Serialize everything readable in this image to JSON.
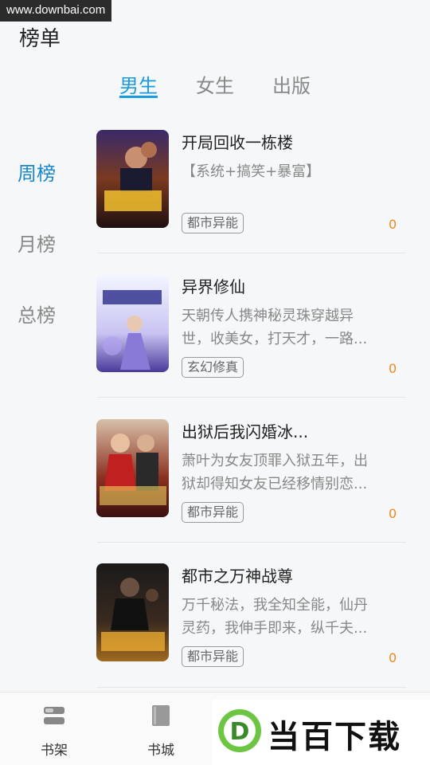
{
  "watermark": {
    "site": "www.downbai.com",
    "brand": "当百下载",
    "logo_letter": "D"
  },
  "page": {
    "title": "榜单"
  },
  "tabs": [
    {
      "label": "男生",
      "active": true
    },
    {
      "label": "女生",
      "active": false
    },
    {
      "label": "出版",
      "active": false
    }
  ],
  "side_nav": [
    {
      "label": "周榜",
      "active": true
    },
    {
      "label": "月榜",
      "active": false
    },
    {
      "label": "总榜",
      "active": false
    }
  ],
  "books": [
    {
      "title": "开局回收一栋楼",
      "desc": "【系统+搞笑+暴富】",
      "tag": "都市异能",
      "count": "0",
      "cover_text": "开局回收一栋楼"
    },
    {
      "title": "异界修仙",
      "desc": "天朝传人携神秘灵珠穿越异世，收美女，打天才，一路...",
      "tag": "玄幻修真",
      "count": "0",
      "cover_text": "异界修仙"
    },
    {
      "title": "出狱后我闪婚冰...",
      "desc": "萧叶为女友顶罪入狱五年，出狱却得知女友已经移情别恋...",
      "tag": "都市异能",
      "count": "0",
      "cover_text": "出狱后我闪婚冰山女总裁"
    },
    {
      "title": "都市之万神战尊",
      "desc": "万千秘法，我全知全能，仙丹灵药，我伸手即来，纵千夫...",
      "tag": "都市异能",
      "count": "0",
      "cover_text": "都市之万神战尊"
    }
  ],
  "bottom_nav": [
    {
      "label": "书架",
      "icon": "bookshelf-icon"
    },
    {
      "label": "书城",
      "icon": "book-icon"
    }
  ],
  "colors": {
    "accent": "#1a9be0",
    "count": "#f08a1f",
    "muted": "#888888"
  }
}
